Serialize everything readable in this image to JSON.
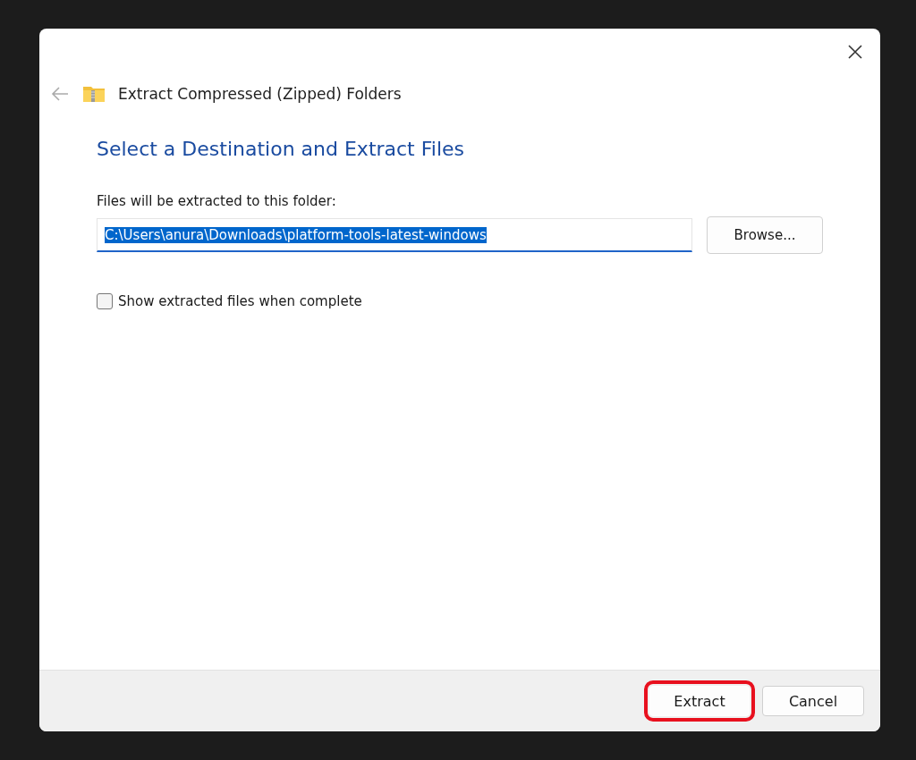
{
  "window": {
    "title": "Extract Compressed (Zipped) Folders"
  },
  "heading": "Select a Destination and Extract Files",
  "destination": {
    "label": "Files will be extracted to this folder:",
    "value": "C:\\Users\\anura\\Downloads\\platform-tools-latest-windows",
    "text_selected": true,
    "browse_button": "Browse..."
  },
  "options": [
    {
      "label": "Show extracted files when complete",
      "checked": false
    }
  ],
  "buttons": [
    {
      "label": "Extract",
      "highlighted": true
    },
    {
      "label": "Cancel",
      "highlighted": false
    }
  ]
}
